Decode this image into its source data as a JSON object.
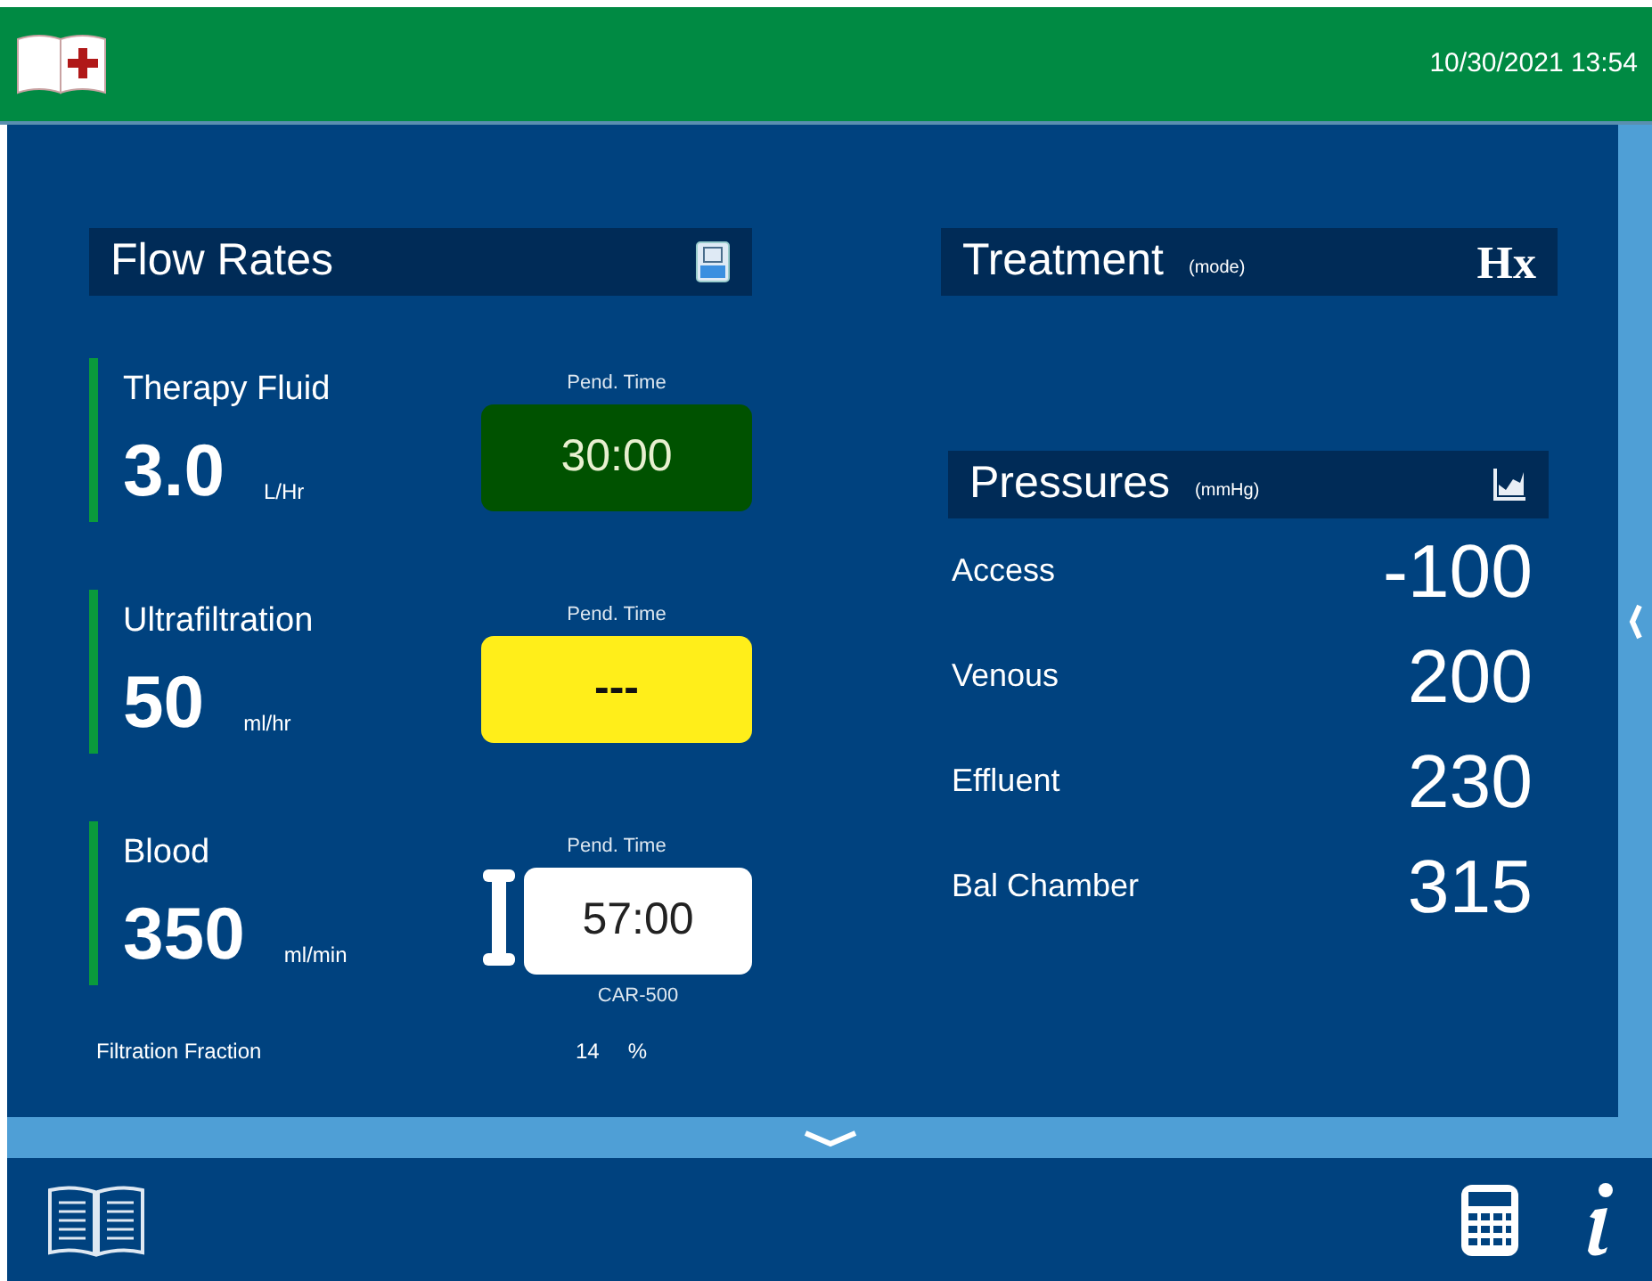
{
  "header": {
    "datetime": "10/30/2021 13:54"
  },
  "flow_rates": {
    "title": "Flow Rates",
    "rows": [
      {
        "label": "Therapy Fluid",
        "value": "3.0",
        "unit": "L/Hr",
        "pend_label": "Pend. Time",
        "pend_value": "30:00",
        "kind": "running"
      },
      {
        "label": "Ultrafiltration",
        "value": "50",
        "unit": "ml/hr",
        "pend_label": "Pend. Time",
        "pend_value": "---",
        "kind": "pending"
      },
      {
        "label": "Blood",
        "value": "350",
        "unit": "ml/min",
        "pend_label": "Pend. Time",
        "pend_value": "57:00",
        "kind": "syringe",
        "sub_label": "CAR-500"
      }
    ],
    "filtration": {
      "label": "Filtration Fraction",
      "value": "14",
      "unit": "%"
    }
  },
  "treatment": {
    "title": "Treatment",
    "note": "(mode)",
    "mode": "Hx"
  },
  "pressures": {
    "title": "Pressures",
    "note": "(mmHg)",
    "rows": [
      {
        "label": "Access",
        "value": "-100"
      },
      {
        "label": "Venous",
        "value": "200"
      },
      {
        "label": "Effluent",
        "value": "230"
      },
      {
        "label": "Bal Chamber",
        "value": "315"
      }
    ]
  }
}
